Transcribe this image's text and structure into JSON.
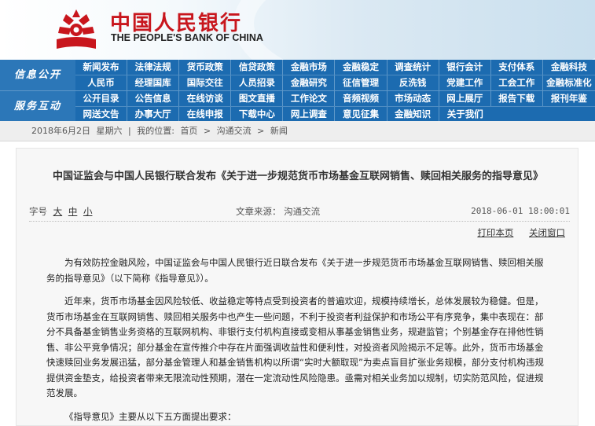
{
  "header": {
    "bank_name_cn": "中国人民银行",
    "bank_name_en": "THE PEOPLE'S BANK OF CHINA",
    "logo_color": "#c8161d"
  },
  "nav": {
    "section1_label": "信息公开",
    "section2_label": "服务互动",
    "row1": [
      "新闻发布",
      "法律法规",
      "货币政策",
      "信贷政策",
      "金融市场",
      "金融稳定",
      "调查统计",
      "银行会计",
      "支付体系",
      "金融科技"
    ],
    "row2": [
      "人民币",
      "经理国库",
      "国际交往",
      "人员招录",
      "金融研究",
      "征信管理",
      "反洗钱",
      "党建工作",
      "工会工作",
      "金融标准化"
    ],
    "row3": [
      "公开目录",
      "公告信息",
      "在线访谈",
      "图文直播",
      "工作论文",
      "音频视频",
      "市场动态",
      "网上展厅",
      "报告下载",
      "报刊年鉴"
    ],
    "row4": [
      "网送文告",
      "办事大厅",
      "在线申报",
      "下载中心",
      "网上调查",
      "意见征集",
      "金融知识",
      "关于我们"
    ]
  },
  "breadcrumb": {
    "date": "2018年6月2日",
    "weekday": "星期六",
    "location_label": "我的位置:",
    "home": "首页",
    "section": "沟通交流",
    "current": "新闻",
    "sep": ">"
  },
  "article": {
    "title": "中国证监会与中国人民银行联合发布《关于进一步规范货币市场基金互联网销售、赎回相关服务的指导意见》",
    "font_size_label": "字号",
    "font_large": "大",
    "font_medium": "中",
    "font_small": "小",
    "source": "文章来源：  沟通交流",
    "datetime": "2018-06-01  18:00:01",
    "print_label": "打印本页",
    "close_label": "关闭窗口",
    "paragraphs": [
      "为有效防控金融风险，中国证监会与中国人民银行近日联合发布《关于进一步规范货币市场基金互联网销售、赎回相关服务的指导意见》（以下简称《指导意见》）。",
      "近年来，货币市场基金因风险较低、收益稳定等特点受到投资者的普遍欢迎，规模持续增长，总体发展较为稳健。但是，货币市场基金在互联网销售、赎回相关服务中也产生一些问题，不利于投资者利益保护和市场公平有序竞争，集中表现在：部分不具备基金销售业务资格的互联网机构、非银行支付机构直接或变相从事基金销售业务，规避监管；个别基金存在排他性销售、非公平竞争情况；部分基金在宣传推介中存在片面强调收益性和便利性，对投资者风险揭示不足等。此外，货币市场基金快速赎回业务发展迅猛，部分基金管理人和基金销售机构以所谓“实时大额取现”为卖点盲目扩张业务规模，部分支付机构违规提供资金垫支，给投资者带来无限流动性预期，潜在一定流动性风险隐患。亟需对相关业务加以规制，切实防范风险，促进规范发展。",
      "《指导意见》主要从以下五方面提出要求："
    ]
  }
}
